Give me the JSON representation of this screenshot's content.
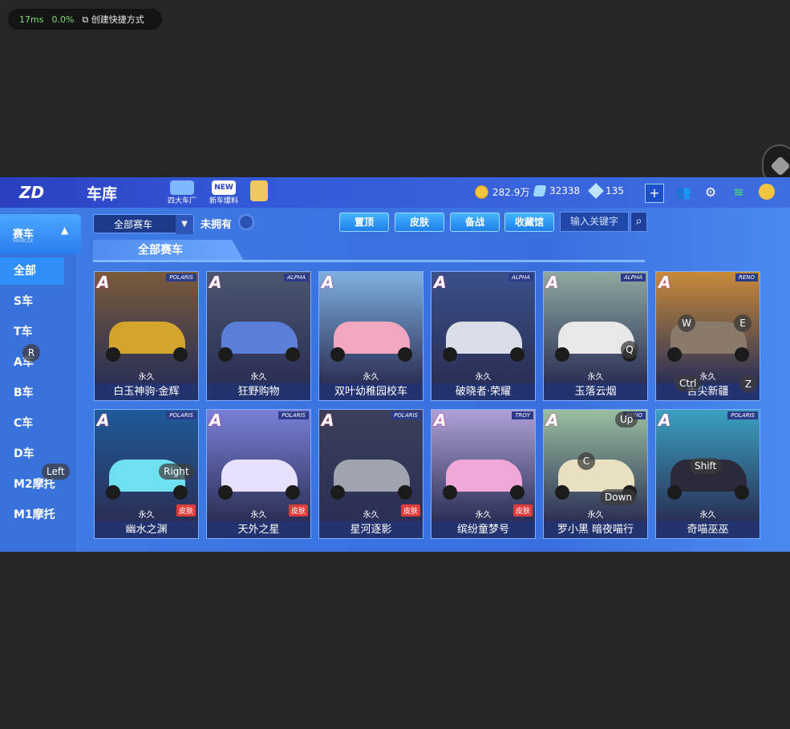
{
  "overlay": {
    "fps": "17ms",
    "cpu": "0.0%",
    "shortcut_label": "创建快捷方式"
  },
  "header": {
    "title": "车库",
    "icons": [
      {
        "label": "四大车厂",
        "icon": "factory-icon"
      },
      {
        "label": "新车爆料",
        "icon": "new-icon"
      },
      {
        "label": "",
        "icon": "gift-icon"
      }
    ],
    "coins": "282.9万",
    "tickets": "32338",
    "diamonds": "135"
  },
  "sidebar": {
    "active_tab": {
      "label": "赛车",
      "sub": "VEHICLE"
    },
    "categories": [
      "全部",
      "S车",
      "T车",
      "A车",
      "B车",
      "C车",
      "D车",
      "M2摩托",
      "M1摩托"
    ],
    "selected": "全部"
  },
  "filters": {
    "dropdown": "全部赛车",
    "unowned": "未拥有",
    "buttons": [
      "置顶",
      "皮肤",
      "备战",
      "收藏馆"
    ],
    "search_placeholder": "输入关键字"
  },
  "section_title": "全部赛车",
  "cards": [
    {
      "name": "白玉神驹·金辉",
      "status": "永久",
      "grade": "A",
      "brand": "POLARIS",
      "skin": "",
      "bg": "#7a5a3a",
      "car": "#d4a52c"
    },
    {
      "name": "狂野购物",
      "status": "永久",
      "grade": "A",
      "brand": "ALPHA",
      "skin": "",
      "bg": "#4a5670",
      "car": "#5a7fd8"
    },
    {
      "name": "双叶幼稚园校车",
      "status": "永久",
      "grade": "A",
      "brand": "",
      "skin": "",
      "bg": "#7fb0e0",
      "car": "#f2a6c0"
    },
    {
      "name": "破晓者·荣耀",
      "status": "永久",
      "grade": "A",
      "brand": "ALPHA",
      "skin": "",
      "bg": "#3a4f8a",
      "car": "#d9dde8"
    },
    {
      "name": "玉落云烟",
      "status": "永久",
      "grade": "A",
      "brand": "ALPHA",
      "skin": "",
      "bg": "#8fa8a0",
      "car": "#e8e8e8"
    },
    {
      "name": "舌尖新疆",
      "status": "永久",
      "grade": "A",
      "brand": "RENO",
      "skin": "",
      "bg": "#c88a3a",
      "car": "#8a7a6a"
    },
    {
      "name": "幽水之渊",
      "status": "永久",
      "grade": "A",
      "brand": "POLARIS",
      "skin": "皮肤",
      "bg": "#1f5a9a",
      "car": "#6fe0f0"
    },
    {
      "name": "天外之星",
      "status": "永久",
      "grade": "A",
      "brand": "POLARIS",
      "skin": "皮肤",
      "bg": "#7a7fd8",
      "car": "#e8e0ff"
    },
    {
      "name": "星河逐影",
      "status": "永久",
      "grade": "A",
      "brand": "POLARIS",
      "skin": "皮肤",
      "bg": "#3a3f5a",
      "car": "#a0a4ae"
    },
    {
      "name": "缤纷童梦号",
      "status": "永久",
      "grade": "A",
      "brand": "TROY",
      "skin": "皮肤",
      "bg": "#b0a0d8",
      "car": "#f0a8d8"
    },
    {
      "name": "罗小黑 暗夜喵行",
      "status": "永久",
      "grade": "A",
      "brand": "RENO",
      "skin": "",
      "bg": "#9abfa0",
      "car": "#e8e0c0"
    },
    {
      "name": "奇喵巫巫",
      "status": "永久",
      "grade": "A",
      "brand": "POLARIS",
      "skin": "",
      "bg": "#3aa0c0",
      "car": "#2a2a3a"
    }
  ],
  "key_overlays": [
    "R",
    "Left",
    "Right",
    "Q",
    "W",
    "E",
    "Ctrl",
    "Z",
    "Up",
    "C",
    "Down",
    "Shift"
  ]
}
